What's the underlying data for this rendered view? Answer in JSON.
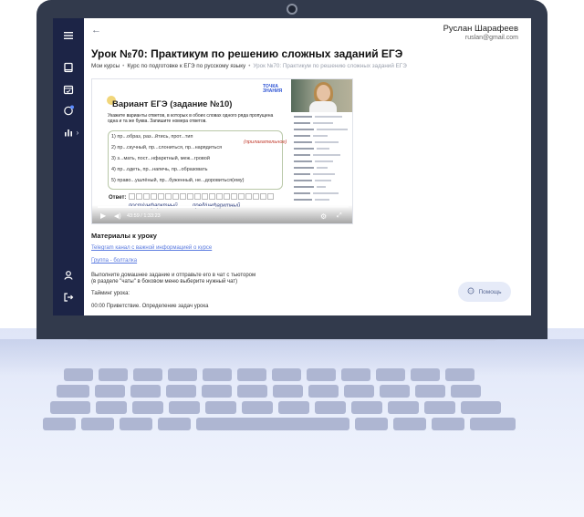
{
  "user": {
    "name": "Руслан Шарафеев",
    "email": "ruslan@gmail.com"
  },
  "page": {
    "title": "Урок №70: Практикум по решению сложных заданий ЕГЭ",
    "back_icon": "arrow-left-icon"
  },
  "breadcrumb": [
    "Мои курсы",
    "Курс по подготовке к ЕГЭ по русскому языку",
    "Урок №70: Практикум по решению сложных заданий ЕГЭ"
  ],
  "sidebar": {
    "icons": [
      "menu-icon",
      "book-icon",
      "calendar-icon",
      "chat-icon",
      "chart-icon",
      "chevron-right-icon",
      "user-icon",
      "logout-icon"
    ]
  },
  "video": {
    "slide_title": "Вариант ЕГЭ (задание №10)",
    "brand": "ТОЧКА ЗНАНИЯ",
    "task": "Укажите варианты ответов, в которых в обоих словах одного ряда пропущена одна и та же буква. Запишите номера ответов.",
    "lines": [
      "1)  пр...образ, раз...йтись, прот...тип",
      "2)  пр...скучный, пр...слониться, пр...нарядиться",
      "3)  з...мать, пост...нфарктный, меж...гровой",
      "4)  пр...одеть, пр...напечь, пр...образовать",
      "5)  право...ушлёный, пр...буженный, не...доровиться(ему)"
    ],
    "answer_label": "Ответ:",
    "hand_notes": [
      "(прилагательное)",
      "пост/инфарктный",
      "пред/инфарктный"
    ],
    "time": "43:59 / 1:33:23",
    "progress": 0.47
  },
  "materials": {
    "title": "Материалы к уроку",
    "link1": "Telegram канал с важной информацией о курсе",
    "link2": "Группа - болталка",
    "homework_line1": "Выполните домашнее задание и отправьте его в чат с тьютором",
    "homework_line2": "(в разделе \"чаты\" в боковом меню выберите нужный чат)",
    "timing_title": "Тайминг урока:",
    "timing_item": "00:00 Приветствие. Определение задач урока"
  },
  "help": {
    "label": "Помощь",
    "icon": "chat-bubble-icon"
  }
}
